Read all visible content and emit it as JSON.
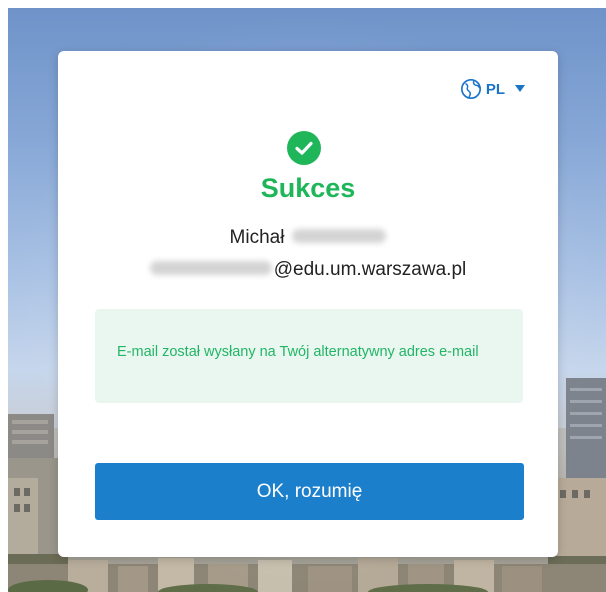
{
  "language": {
    "code": "PL",
    "icon": "globe-icon"
  },
  "dialog": {
    "status_icon": "check-circle-icon",
    "title": "Sukces",
    "first_name": "Michał",
    "email_domain": "@edu.um.warszawa.pl",
    "message": "E-mail został wysłany na Twój alternatywny adres e-mail",
    "ok_label": "OK, rozumię"
  },
  "colors": {
    "success": "#1fb65a",
    "primary": "#1b7fcb",
    "notice_bg": "#e9f7f0"
  }
}
